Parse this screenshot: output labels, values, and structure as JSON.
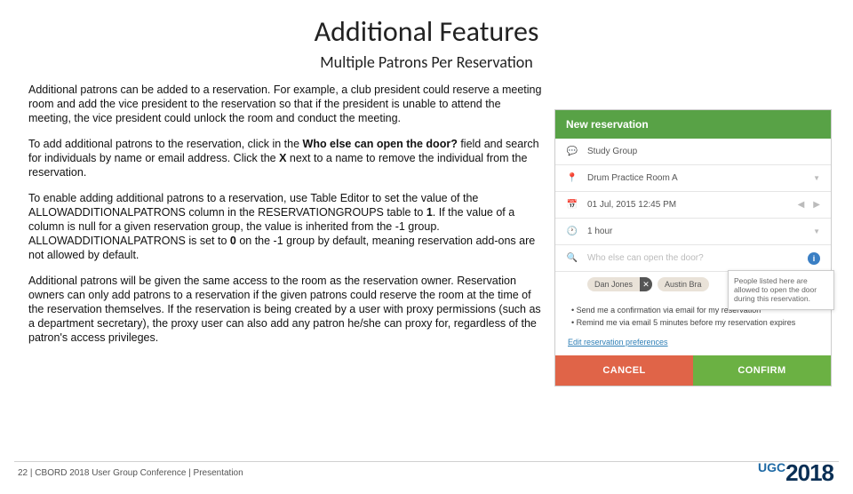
{
  "title": "Additional Features",
  "subtitle": "Multiple Patrons Per Reservation",
  "paragraphs": {
    "p1": "Additional patrons can be added to a reservation. For example, a club president could reserve a meeting room and add the vice president to the reservation so that if the president is unable to attend the meeting, the vice president could unlock the room and conduct the meeting.",
    "p2a": "To add additional patrons to the reservation, click in the ",
    "p2b": "Who else can open the door?",
    "p2c": " field and search for individuals by name or email address. Click the ",
    "p2d": "X",
    "p2e": " next to a name to remove the individual from the reservation.",
    "p3a": "To enable adding additional patrons to a reservation, use Table Editor to set the value of the ALLOWADDITIONALPATRONS column in the RESERVATIONGROUPS table to ",
    "p3b": "1",
    "p3c": ". If the value of a column is null for a given reservation group, the value is inherited from the -1 group. ALLOWADDITIONALPATRONS is set to ",
    "p3d": "0",
    "p3e": " on the -1 group by default, meaning reservation add-ons are not allowed by default.",
    "p4": "Additional patrons will be given the same access to the room as the reservation owner. Reservation owners can only add patrons to a reservation if the given patrons could reserve the room at the time of the reservation themselves. If the reservation is being created by a user with proxy permissions (such as a department secretary), the proxy user can also add any patron he/she can proxy for, regardless of the patron's access privileges."
  },
  "panel": {
    "header": "New reservation",
    "subject": "Study Group",
    "room": "Drum Practice Room A",
    "datetime": "01 Jul, 2015 12:45 PM",
    "duration": "1 hour",
    "who_placeholder": "Who else can open the door?",
    "tag1": "Dan Jones",
    "tag2": "Austin Bra",
    "tooltip": "People listed here are allowed to open the door during this reservation.",
    "check1": "Send me a confirmation via email for my reservation",
    "check2": "Remind me via email 5 minutes before my reservation expires",
    "pref_link": "Edit reservation preferences",
    "cancel": "CANCEL",
    "confirm": "CONFIRM"
  },
  "footer": {
    "page": "22",
    "sep": "|",
    "text": "CBORD 2018 User Group Conference | Presentation",
    "logo_ugc": "UGC",
    "logo_year": "2018"
  }
}
